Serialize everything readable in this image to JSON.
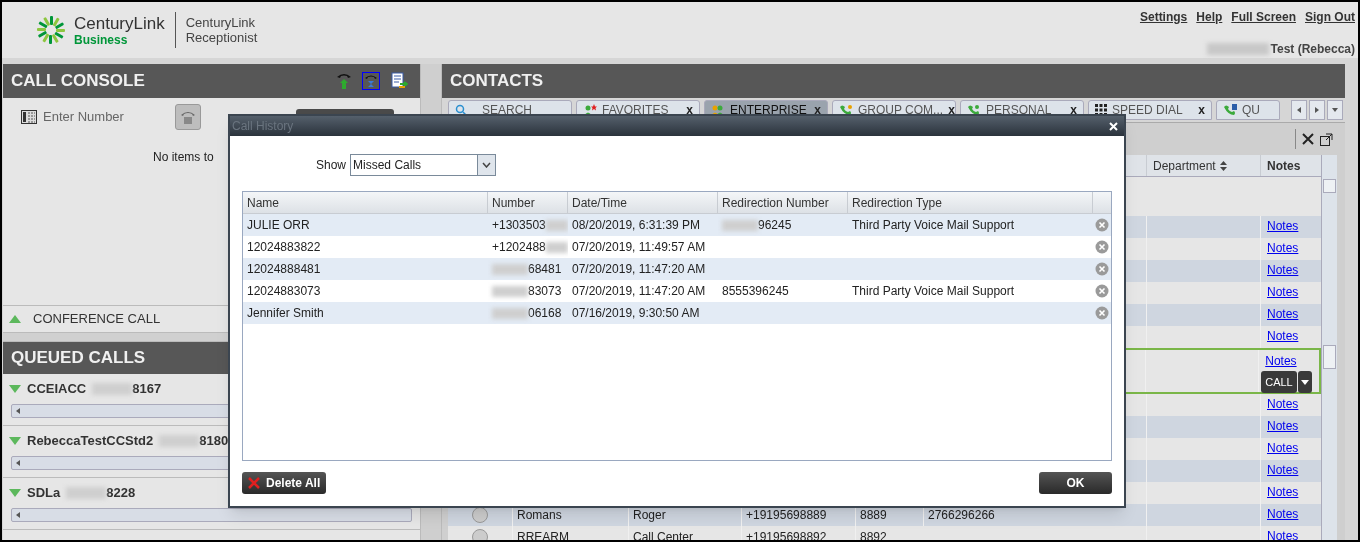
{
  "header": {
    "logo": {
      "brand": "CenturyLink",
      "sub": "Business",
      "product_line1": "CenturyLink",
      "product_line2": "Receptionist"
    },
    "links": [
      "Settings",
      "Help",
      "Full Screen",
      "Sign Out"
    ],
    "user": "Test (Rebecca)"
  },
  "call_console": {
    "title": "CALL CONSOLE",
    "enter_number": {
      "placeholder": "Enter Number"
    },
    "empty_text": "No items to",
    "conference": {
      "label": "CONFERENCE CALL",
      "expanded": false
    }
  },
  "queued_calls": {
    "title": "QUEUED CALLS",
    "items": [
      {
        "name": "CCEIACC",
        "suffix": "8167",
        "expanded": true
      },
      {
        "name": "RebeccaTestCCStd2",
        "suffix": "8180",
        "expanded": true
      },
      {
        "name": "SDLa",
        "suffix": "8228",
        "expanded": true
      }
    ]
  },
  "contacts": {
    "title": "CONTACTS",
    "tabs": [
      {
        "label": "SEARCH",
        "selected": false,
        "kind": "search"
      },
      {
        "label": "FAVORITES",
        "close": "x",
        "selected": false,
        "kind": "favorites"
      },
      {
        "label": "ENTERPRISE",
        "close": "x",
        "selected": true,
        "kind": "enterprise"
      },
      {
        "label": "GROUP COM...",
        "close": "x",
        "selected": false,
        "kind": "group"
      },
      {
        "label": "PERSONAL",
        "close": "x",
        "selected": false,
        "kind": "personal"
      },
      {
        "label": "SPEED DIAL",
        "close": "x",
        "selected": false,
        "kind": "speed"
      },
      {
        "label": "QU",
        "selected": false,
        "kind": "queue"
      }
    ],
    "columns": [
      "Department",
      "Notes"
    ],
    "rows": [
      {
        "notes": "Notes",
        "selected": false
      },
      {
        "notes": "Notes",
        "selected": false
      },
      {
        "notes": "Notes",
        "selected": false
      },
      {
        "notes": "Notes",
        "selected": false
      },
      {
        "notes": "Notes",
        "selected": false
      },
      {
        "notes": "Notes",
        "selected": false
      },
      {
        "notes": "Notes",
        "selected": true,
        "call_button": "CALL"
      },
      {
        "notes": "Notes",
        "selected": false
      },
      {
        "notes": "Notes",
        "selected": false
      },
      {
        "notes": "Notes",
        "selected": false
      },
      {
        "notes": "Notes",
        "selected": false
      },
      {
        "notes": "Notes",
        "selected": false
      },
      {
        "notes": "Notes",
        "selected": false,
        "cells": [
          "Romans",
          "Roger",
          "+19195698889",
          "8889",
          "2766296266"
        ]
      },
      {
        "notes": "Notes",
        "selected": false,
        "cells": [
          "RREARM",
          "Call Center",
          "+19195698892",
          "8892"
        ]
      }
    ]
  },
  "dialog": {
    "title": "Call History",
    "show_label": "Show",
    "show_value": "Missed Calls",
    "columns": [
      "Name",
      "Number",
      "Date/Time",
      "Redirection Number",
      "Redirection Type"
    ],
    "rows": [
      {
        "name": "JULIE ORR",
        "number": "+1303503",
        "datetime": "08/20/2019, 6:31:39 PM",
        "redirection_number": "96245",
        "redirection_type": "Third Party Voice Mail Support"
      },
      {
        "name": "12024883822",
        "number": "+1202488",
        "datetime": "07/20/2019, 11:49:57 AM"
      },
      {
        "name": "12024888481",
        "number": "68481",
        "datetime": "07/20/2019, 11:47:20 AM"
      },
      {
        "name": "12024883073",
        "number": "83073",
        "datetime": "07/20/2019, 11:47:20 AM",
        "redirection_number": "8555396245",
        "redirection_type": "Third Party Voice Mail Support"
      },
      {
        "name": "Jennifer Smith",
        "number": "06168",
        "datetime": "07/16/2019, 9:30:50 AM"
      }
    ],
    "delete_all": "Delete All",
    "ok": "OK"
  }
}
